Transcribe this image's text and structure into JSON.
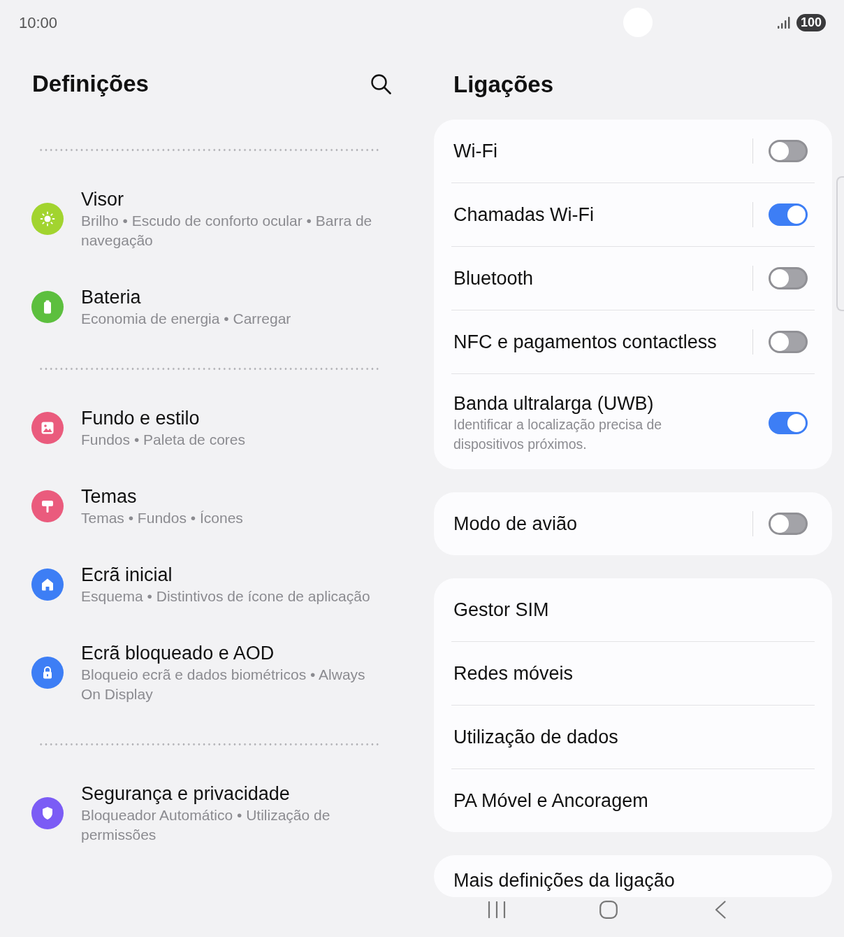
{
  "status_bar": {
    "time": "10:00",
    "battery": "100"
  },
  "settings": {
    "title": "Definições",
    "groups": [
      {
        "items": [
          {
            "title": "Visor",
            "subtitle": "Brilho • Escudo de conforto ocular • Barra de navegação",
            "color": "#a2d42f"
          },
          {
            "title": "Bateria",
            "subtitle": "Economia de energia • Carregar",
            "color": "#5cbf3e"
          }
        ]
      },
      {
        "items": [
          {
            "title": "Fundo e estilo",
            "subtitle": "Fundos • Paleta de cores",
            "color": "#ea5b7d"
          },
          {
            "title": "Temas",
            "subtitle": "Temas • Fundos • Ícones",
            "color": "#ea5b7d"
          },
          {
            "title": "Ecrã inicial",
            "subtitle": "Esquema • Distintivos de ícone de aplicação",
            "color": "#3d7ef5"
          },
          {
            "title": "Ecrã bloqueado e AOD",
            "subtitle": "Bloqueio ecrã e dados biométricos • Always On Display",
            "color": "#3d7ef5"
          }
        ]
      },
      {
        "items": [
          {
            "title": "Segurança e privacidade",
            "subtitle": "Bloqueador Automático • Utilização de permissões",
            "color": "#7b5cf5"
          }
        ]
      }
    ]
  },
  "connections": {
    "title": "Ligações",
    "cards": [
      {
        "rows": [
          {
            "label": "Wi-Fi",
            "kind": "split_toggle",
            "on": false
          },
          {
            "label": "Chamadas Wi-Fi",
            "kind": "split_toggle",
            "on": true
          },
          {
            "label": "Bluetooth",
            "kind": "split_toggle",
            "on": false
          },
          {
            "label": "NFC e pagamentos contactless",
            "kind": "split_toggle",
            "on": false
          },
          {
            "label": "Banda ultralarga (UWB)",
            "kind": "toggle",
            "on": true,
            "subtitle": "Identificar a localização precisa de dispositivos próximos."
          }
        ]
      },
      {
        "rows": [
          {
            "label": "Modo de avião",
            "kind": "split_toggle",
            "on": false
          }
        ]
      },
      {
        "rows": [
          {
            "label": "Gestor SIM",
            "kind": "link"
          },
          {
            "label": "Redes móveis",
            "kind": "link"
          },
          {
            "label": "Utilização de dados",
            "kind": "link"
          },
          {
            "label": "PA Móvel e Ancoragem",
            "kind": "link"
          }
        ]
      },
      {
        "rows": [
          {
            "label": "Mais definições da ligação",
            "kind": "link"
          }
        ]
      }
    ]
  }
}
